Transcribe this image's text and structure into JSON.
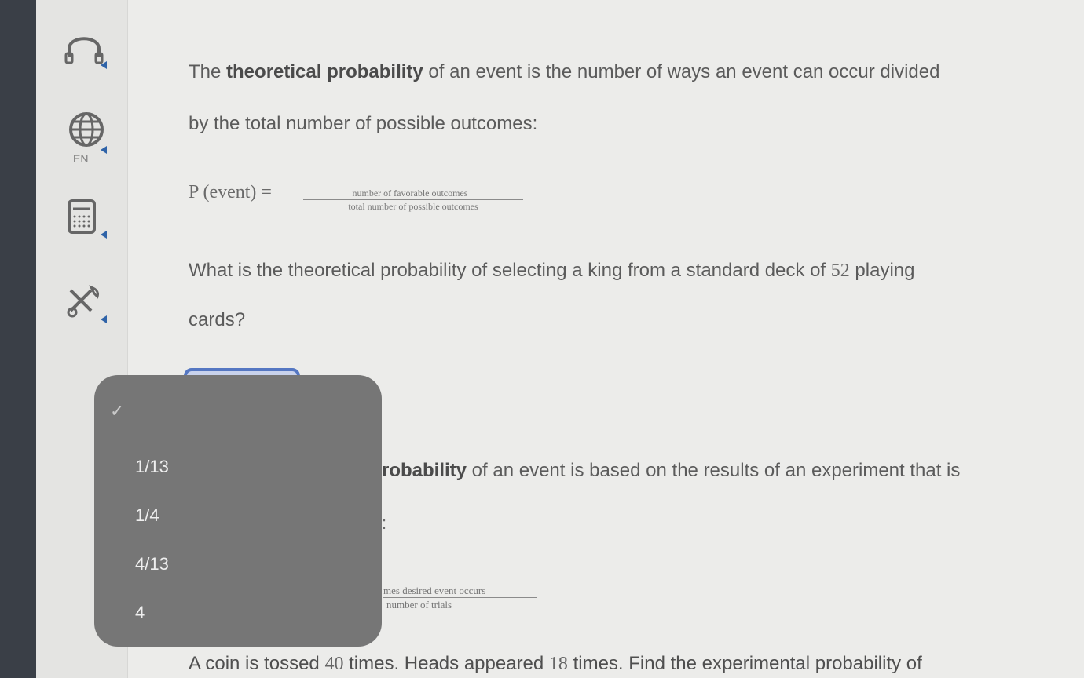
{
  "sidebar": {
    "tools": [
      {
        "name": "headphones",
        "label": ""
      },
      {
        "name": "language",
        "label": "EN"
      },
      {
        "name": "calculator",
        "label": ""
      },
      {
        "name": "tools",
        "label": ""
      }
    ]
  },
  "content": {
    "paragraph1": {
      "prefix": "The ",
      "bold": "theoretical probability",
      "suffix": " of an event is the number of ways an event can occur divided",
      "line2": "by the total number of possible outcomes:"
    },
    "formula1": {
      "lhs": "P (event) =",
      "numerator": "number of favorable outcomes",
      "denominator": "total number of possible outcomes"
    },
    "question1": {
      "line1_prefix": "What is the theoretical probability of selecting a king from a standard deck of ",
      "number": "52",
      "line1_suffix": " playing",
      "line2": "cards?"
    },
    "dropdown": {
      "options": [
        "1/13",
        "1/4",
        "4/13",
        "4"
      ],
      "check": "✓"
    },
    "paragraph2": {
      "bold_visible": "robability",
      "suffix": " of an event is based on the results of an experiment that is",
      "colon": ":"
    },
    "formula2": {
      "numerator_visible": "mes desired event occurs",
      "denominator_visible": "number of trials"
    },
    "question2": {
      "prefix": "A coin is tossed ",
      "n1": "40",
      "middle": " times. Heads appeared ",
      "n2": "18",
      "suffix": " times. Find the experimental probability of"
    }
  }
}
